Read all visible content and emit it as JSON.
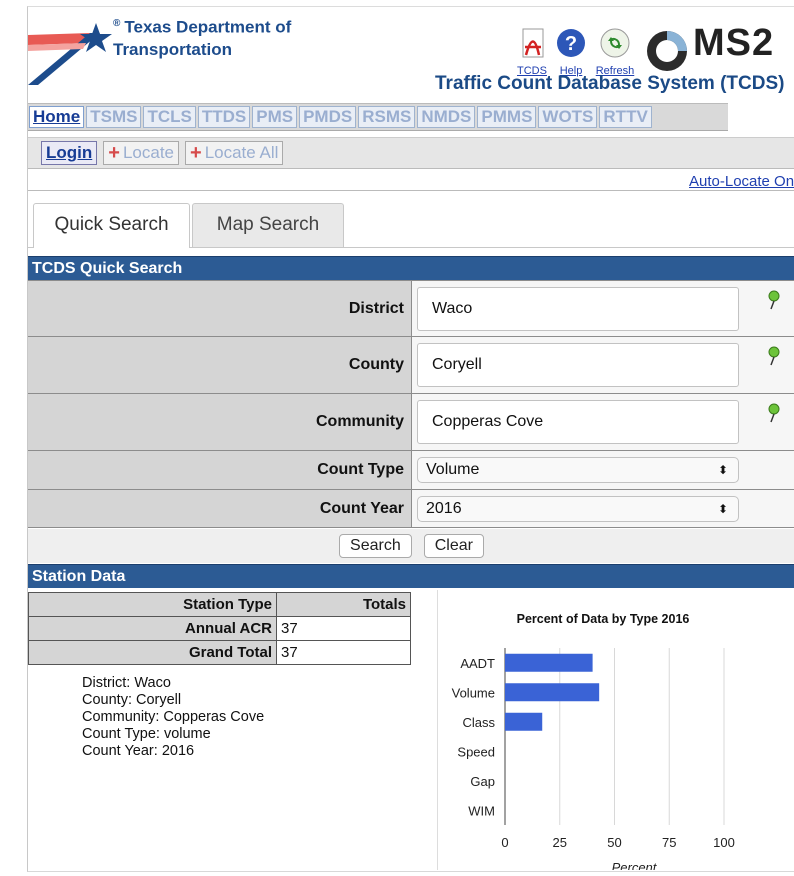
{
  "header": {
    "agency_line1": "Texas Department of",
    "agency_line2": "Transportation",
    "reg_mark": "®",
    "icons": [
      {
        "label": "TCDS",
        "icon": "pdf-icon"
      },
      {
        "label": "Help",
        "icon": "help-icon"
      },
      {
        "label": "Refresh",
        "icon": "refresh-icon"
      }
    ],
    "brand": "MS2",
    "system_title": "Traffic Count Database System (TCDS)"
  },
  "nav": {
    "tabs": [
      "Home",
      "TSMS",
      "TCLS",
      "TTDS",
      "PMS",
      "PMDS",
      "RSMS",
      "NMDS",
      "PMMS",
      "WOTS",
      "RTTV"
    ]
  },
  "toolbar": {
    "login": "Login",
    "locate": "Locate",
    "locate_all": "Locate All",
    "auto_locate": "Auto-Locate On"
  },
  "search_tabs": [
    "Quick Search",
    "Map Search"
  ],
  "quick_search": {
    "title": "TCDS Quick Search",
    "district_label": "District",
    "district_value": "Waco",
    "county_label": "County",
    "county_value": "Coryell",
    "community_label": "Community",
    "community_value": "Copperas Cove",
    "count_type_label": "Count Type",
    "count_type_value": "Volume",
    "count_year_label": "Count Year",
    "count_year_value": "2016",
    "search_button": "Search",
    "clear_button": "Clear",
    "select_arrow": "⬍"
  },
  "station_data": {
    "title": "Station Data",
    "col_station_type": "Station Type",
    "col_totals": "Totals",
    "rows": [
      {
        "label": "Annual ACR",
        "value": "37"
      },
      {
        "label": "Grand Total",
        "value": "37"
      }
    ],
    "summary": [
      "District: Waco",
      "County: Coryell",
      "Community: Copperas Cove",
      "Count Type: volume",
      "Count Year: 2016"
    ]
  },
  "colors": {
    "section_header": "#2c5b94",
    "nav_active": "#173c95",
    "bar": "#3a63d6"
  },
  "chart_data": {
    "type": "bar",
    "orientation": "horizontal",
    "title": "Percent of Data by Type 2016",
    "categories": [
      "AADT",
      "Volume",
      "Class",
      "Speed",
      "Gap",
      "WIM"
    ],
    "values": [
      40,
      43,
      17,
      0,
      0,
      0
    ],
    "xlabel": "Percent",
    "ylabel": "",
    "xlim": [
      0,
      100
    ],
    "xticks": [
      0,
      25,
      50,
      75,
      100
    ],
    "grid": true
  }
}
